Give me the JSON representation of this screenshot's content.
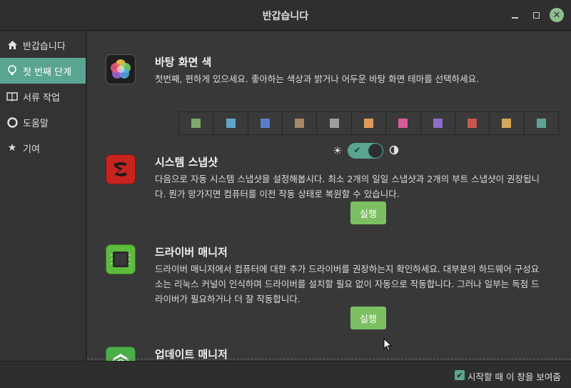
{
  "window": {
    "title": "반갑습니다"
  },
  "colors": {
    "accent": "#5aa592",
    "run_button": "#7cbf63"
  },
  "sidebar": {
    "items": [
      {
        "label": "반갑습니다",
        "icon": "home-icon"
      },
      {
        "label": "첫 번째 단계",
        "icon": "lightbulb-icon",
        "active": true
      },
      {
        "label": "서류 작업",
        "icon": "book-icon"
      },
      {
        "label": "도움말",
        "icon": "lifebuoy-icon"
      },
      {
        "label": "기여",
        "icon": "star-icon"
      }
    ]
  },
  "sections": {
    "desktop_colors": {
      "title": "바탕 화면 색",
      "description": "첫번째, 편하게 있으세요. 좋아하는 색상과 밝거나 어두운 바탕 화면 테마를 선택하세요.",
      "swatches": [
        "#7ea86a",
        "#5fa5c9",
        "#5b7dc9",
        "#a7866a",
        "#9e9e9e",
        "#e09b5c",
        "#d65c9a",
        "#8e6bc9",
        "#c9574f",
        "#d4a95c",
        "#5aa592"
      ],
      "dark_mode_on": true
    },
    "system_snapshots": {
      "title": "시스템 스냅샷",
      "description": "다음으로 자동 시스템 스냅샷을 설정해봅시다. 최소 2개의 일일 스냅샷과 2개의 부트 스냅샷이 권장됩니다. 뭔가 망가지면 컴퓨터를 이전 작동 상태로 복원할 수 있습니다.",
      "button": "실행"
    },
    "driver_manager": {
      "title": "드라이버 매니저",
      "description": "드라이버 매니저에서 컴퓨터에 대한 추가 드라이버를 권장하는지 확인하세요. 대부분의 하드웨어 구성요소는 리눅스 커널이 인식하며 드라이버를 설치할 필요 없이 자동으로 작동합니다. 그러나 일부는 독점 드라이버가 필요하거나 더 잘 작동합니다.",
      "button": "실행"
    },
    "update_manager": {
      "title": "업데이트 매니저"
    }
  },
  "footer": {
    "show_on_startup_label": "시작할 때 이 창을 보여줌",
    "checked": true
  }
}
